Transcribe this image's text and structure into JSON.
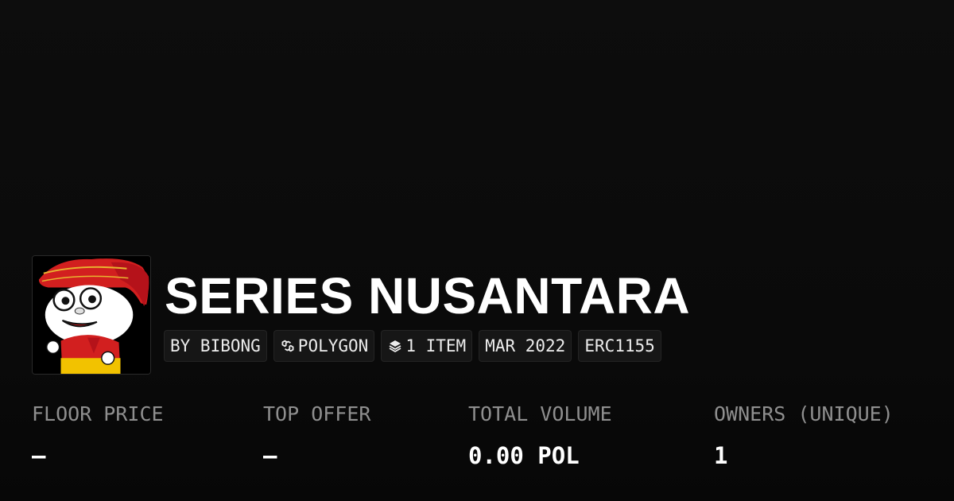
{
  "collection": {
    "title": "SERIES NUSANTARA",
    "avatar_icon": "cartoon-mascot-avatar",
    "chips": {
      "creator": "BY BIBONG",
      "chain": "POLYGON",
      "chain_icon": "polygon-chain-icon",
      "items": "1 ITEM",
      "items_icon": "layers-icon",
      "date": "MAR 2022",
      "standard": "ERC1155"
    }
  },
  "stats": {
    "floor_price": {
      "label": "FLOOR PRICE",
      "value": "–"
    },
    "top_offer": {
      "label": "TOP OFFER",
      "value": "–"
    },
    "total_volume": {
      "label": "TOTAL VOLUME",
      "value": "0.00 POL"
    },
    "owners": {
      "label": "OWNERS (UNIQUE)",
      "value": "1"
    }
  },
  "colors": {
    "background": "#0a0a0a",
    "text": "#ffffff",
    "muted_text": "#8f8f8f",
    "chip_background": "#161616"
  }
}
